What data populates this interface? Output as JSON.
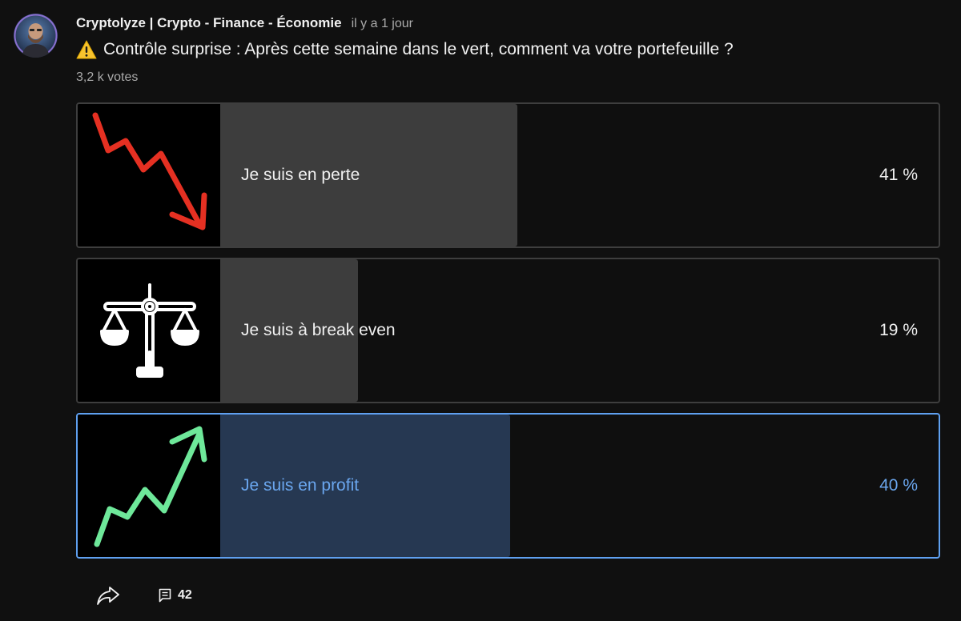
{
  "post": {
    "channel": "Cryptolyze | Crypto - Finance - Économie",
    "time": "il y a 1 jour",
    "question": "Contrôle surprise : Après cette semaine dans le vert, comment va votre portefeuille ?",
    "votes": "3,2 k votes"
  },
  "poll": {
    "options": [
      {
        "label": "Je suis en perte",
        "percent_text": "41 %",
        "percent": 41,
        "image_icon": "red-down-arrow-icon",
        "selected": false
      },
      {
        "label": "Je suis à break even",
        "percent_text": "19 %",
        "percent": 19,
        "image_icon": "balance-scale-icon",
        "selected": false
      },
      {
        "label": "Je suis en profit",
        "percent_text": "40 %",
        "percent": 40,
        "image_icon": "green-up-arrow-icon",
        "selected": true
      }
    ]
  },
  "footer": {
    "comment_count": "42"
  },
  "colors": {
    "background": "#101010",
    "selected_accent": "#6aa6ee",
    "down_arrow": "#e53022",
    "up_arrow": "#6ee89a"
  }
}
